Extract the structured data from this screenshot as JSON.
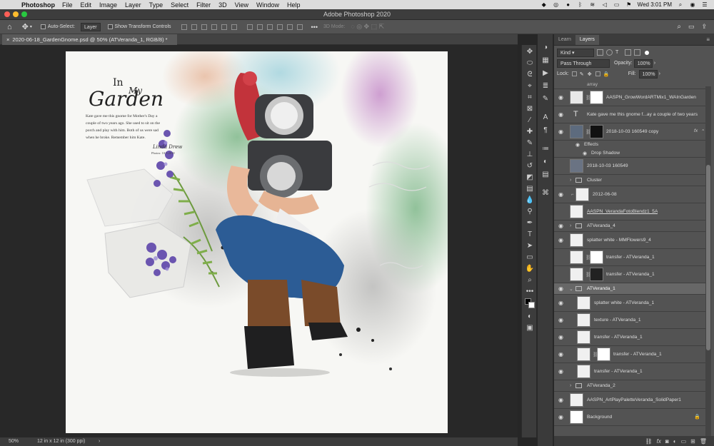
{
  "menubar": {
    "app": "Photoshop",
    "items": [
      "File",
      "Edit",
      "Image",
      "Layer",
      "Type",
      "Select",
      "Filter",
      "3D",
      "View",
      "Window",
      "Help"
    ],
    "clock": "Wed 3:01 PM"
  },
  "window": {
    "title": "Adobe Photoshop 2020"
  },
  "options": {
    "auto_select_label": "Auto-Select:",
    "auto_select_value": "Layer",
    "transform_label": "Show Transform Controls",
    "mode_label": "3D Mode:"
  },
  "document": {
    "tab_label": "2020-06-18_GardenGnome.psd @ 50% (ATVeranda_1, RGB/8) *",
    "zoom": "50%",
    "info": "12 in x 12 in (300 ppi)"
  },
  "artwork": {
    "title_in": "In",
    "title_my": "My",
    "title_garden": "Garden",
    "journal": [
      "Kate gave me this gnome for Mother's Day a",
      "couple of two years ago. She used to sit on the",
      "porch and play with him. Both of us were sad",
      "when he broke. Remember him Kate."
    ],
    "signature": "Linda Drew",
    "photo_credit": "Photos: 10.3.2018"
  },
  "panel": {
    "tabs": [
      "Learn",
      "Layers"
    ],
    "filter_kind": "Kind",
    "blend_mode": "Pass Through",
    "opacity_label": "Opacity:",
    "opacity_value": "100%",
    "lock_label": "Lock:",
    "fill_label": "Fill:",
    "fill_value": "100%",
    "top_partial": "array",
    "layers": [
      {
        "name": "AASPN_GrowWordARTMix1_WAInGarden",
        "kind": "masked",
        "visible": true
      },
      {
        "name": "Kate gave me this gnome f...ay a couple of two years",
        "kind": "text",
        "visible": true
      },
      {
        "name": "2018-10-03 160549 copy",
        "kind": "photo-masked",
        "visible": true,
        "fx": "fx"
      },
      {
        "name": "Effects",
        "kind": "effect"
      },
      {
        "name": "Drop Shadow",
        "kind": "effect-item"
      },
      {
        "name": "2018-10-03 160549",
        "kind": "photo",
        "visible": false
      },
      {
        "name": "Cluster",
        "kind": "group",
        "visible": false
      },
      {
        "name": "2012-06-08",
        "kind": "pixel",
        "visible": true
      },
      {
        "name": "AASPN_VerandaFotoBlendz1_5A",
        "kind": "pixel",
        "visible": false
      },
      {
        "name": "ATVeranda_4",
        "kind": "group",
        "visible": true
      },
      {
        "name": "splatter white - MMFlowers9_4",
        "kind": "pixel",
        "visible": true
      },
      {
        "name": "transfer - ATVeranda_1",
        "kind": "masked",
        "visible": false
      },
      {
        "name": "transfer - ATVeranda_1",
        "kind": "masked",
        "visible": false
      },
      {
        "name": "ATVeranda_1",
        "kind": "group-open",
        "visible": true,
        "selected": true
      },
      {
        "name": "splatter white - ATVeranda_1",
        "kind": "pixel",
        "visible": true
      },
      {
        "name": "texture - ATVeranda_1",
        "kind": "pixel",
        "visible": true
      },
      {
        "name": "transfer - ATVeranda_1",
        "kind": "pixel",
        "visible": true
      },
      {
        "name": "transfer - ATVeranda_1",
        "kind": "masked",
        "visible": true
      },
      {
        "name": "transfer - ATVeranda_1",
        "kind": "pixel",
        "visible": true
      },
      {
        "name": "ATVeranda_2",
        "kind": "group",
        "visible": false
      },
      {
        "name": "AASPN_ArtPlayPaletteVeranda_SolidPaper1",
        "kind": "pixel",
        "visible": true
      },
      {
        "name": "Background",
        "kind": "background",
        "visible": true
      }
    ]
  }
}
